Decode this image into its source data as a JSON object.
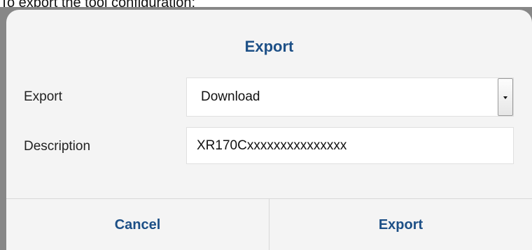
{
  "caption": "To export the tool configuration:",
  "dialog": {
    "title": "Export",
    "export_row": {
      "label": "Export",
      "selected": "Download"
    },
    "description_row": {
      "label": "Description",
      "value": "XR170Cxxxxxxxxxxxxxxx"
    },
    "buttons": {
      "cancel": "Cancel",
      "export": "Export"
    }
  },
  "colors": {
    "accent": "#1c4f86",
    "backdrop": "#878787",
    "dialog_bg": "#f4f4f4"
  }
}
